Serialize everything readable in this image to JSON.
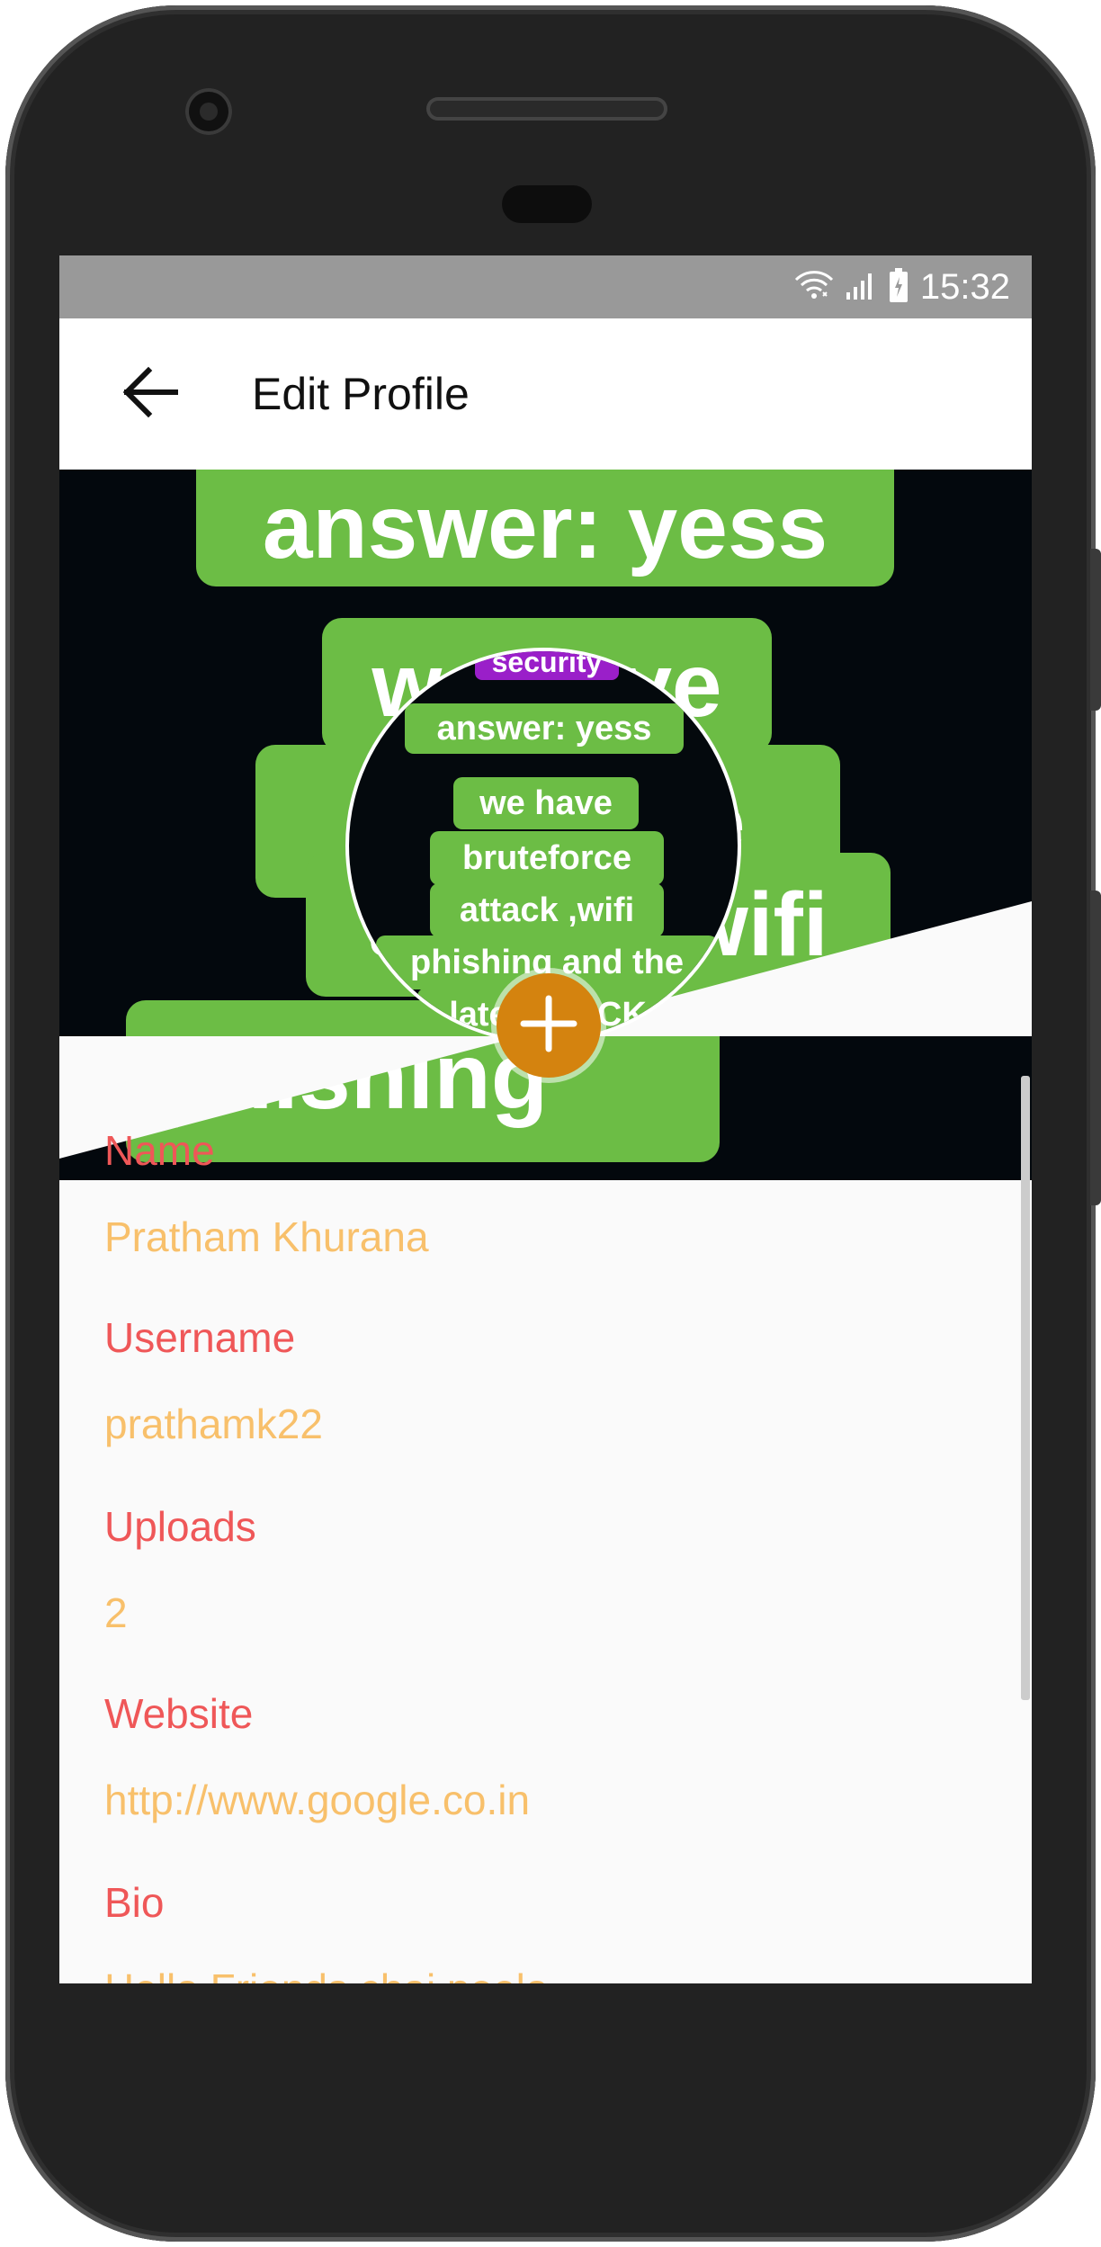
{
  "status_bar": {
    "time": "15:32",
    "icons": [
      "wifi-icon",
      "signal-icon",
      "battery-icon"
    ]
  },
  "app_bar": {
    "back_icon": "arrow-left-icon",
    "title": "Edit Profile"
  },
  "cover_image": {
    "lines": [
      "answer: yess",
      "we have",
      "brutefore",
      "attack ,wifi",
      "phishing"
    ]
  },
  "avatar": {
    "tag": "security",
    "lines": [
      "answer: yess",
      "we have",
      "bruteforce",
      "attack ,wifi",
      "phishing and the",
      "latest HACK"
    ]
  },
  "add_photo": {
    "icon": "plus-icon",
    "color": "#d4830f"
  },
  "fields": [
    {
      "label": "Name",
      "value": "Pratham Khurana"
    },
    {
      "label": "Username",
      "value": "prathamk22"
    },
    {
      "label": "Uploads",
      "value": "2"
    },
    {
      "label": "Website",
      "value": "http://www.google.co.in"
    },
    {
      "label": "Bio",
      "value": "Hello Friends chai peelo"
    }
  ],
  "colors": {
    "label": "#ef5758",
    "value": "#f8c06b",
    "accent": "#d4830f",
    "status_bar": "#999999",
    "cover_green": "#6cbd45"
  }
}
